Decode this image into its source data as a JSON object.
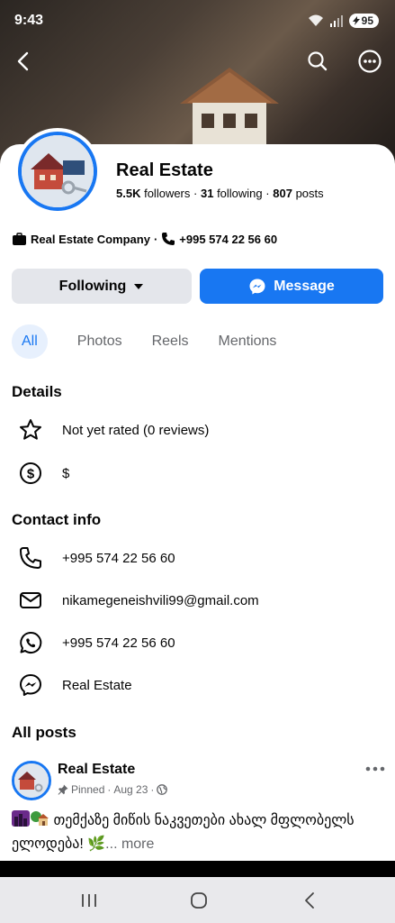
{
  "status": {
    "time": "9:43",
    "battery": "95"
  },
  "page": {
    "name": "Real Estate",
    "followers_count": "5.5K",
    "followers_label": "followers",
    "following_count": "31",
    "following_label": "following",
    "posts_count": "807",
    "posts_label": "posts",
    "category": "Real Estate Company",
    "phone": "+995 574 22 56 60"
  },
  "actions": {
    "following_label": "Following",
    "message_label": "Message"
  },
  "tabs": [
    {
      "label": "All",
      "active": true
    },
    {
      "label": "Photos",
      "active": false
    },
    {
      "label": "Reels",
      "active": false
    },
    {
      "label": "Mentions",
      "active": false
    }
  ],
  "details": {
    "title": "Details",
    "rating": "Not yet rated (0 reviews)",
    "price": "$"
  },
  "contact": {
    "title": "Contact info",
    "phone": "+995 574 22 56 60",
    "email": "nikamegeneishvili99@gmail.com",
    "whatsapp": "+995 574 22 56 60",
    "messenger": "Real Estate"
  },
  "posts": {
    "title": "All posts",
    "items": [
      {
        "author": "Real Estate",
        "pinned_label": "Pinned",
        "date": "Aug 23",
        "text": "თემქაზე მიწის ნაკვეთები ახალ მფლობელს ელოდება! 🌿",
        "more_label": "... more"
      }
    ]
  },
  "colors": {
    "accent": "#1877f2",
    "secondary_button": "#e4e6eb",
    "muted_text": "#65676b"
  }
}
